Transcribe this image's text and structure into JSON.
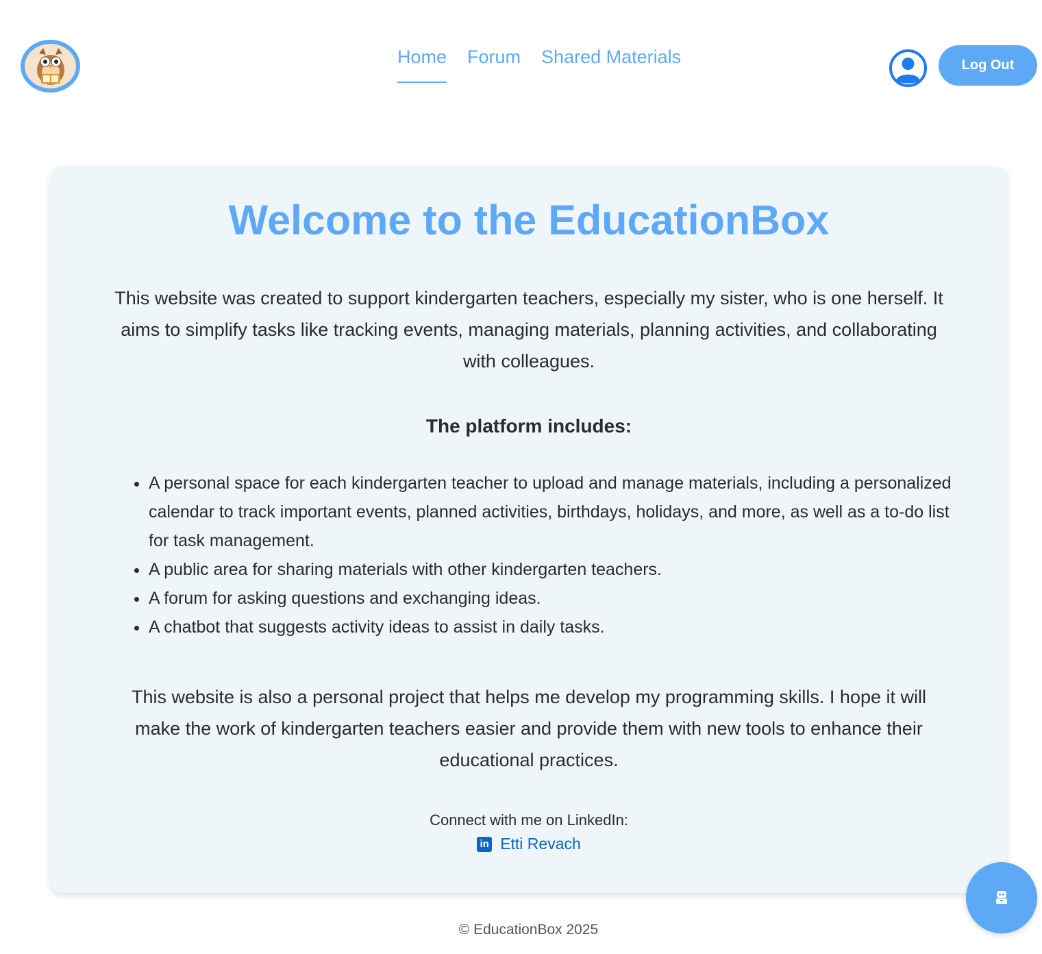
{
  "header": {
    "logo_icon": "owl-reading-book-icon",
    "nav": [
      {
        "label": "Home",
        "active": true
      },
      {
        "label": "Forum",
        "active": false
      },
      {
        "label": "Shared Materials",
        "active": false
      }
    ],
    "user_icon": "user-circle-icon",
    "logout_label": "Log Out"
  },
  "main": {
    "title": "Welcome to the EducationBox",
    "intro": "This website was created to support kindergarten teachers, especially my sister, who is one herself. It aims to simplify tasks like tracking events, managing materials, planning activities, and collaborating with colleagues.",
    "includes_title": "The platform includes:",
    "features": [
      "A personal space for each kindergarten teacher to upload and manage materials, including a personalized calendar to track important events, planned activities, birthdays, holidays, and more, as well as a to-do list for task management.",
      "A public area for sharing materials with other kindergarten teachers.",
      "A forum for asking questions and exchanging ideas.",
      "A chatbot that suggests activity ideas to assist in daily tasks."
    ],
    "outro": "This website is also a personal project that helps me develop my programming skills. I hope it will make the work of kindergarten teachers easier and provide them with new tools to enhance their educational practices.",
    "connect_label": "Connect with me on LinkedIn:",
    "linkedin_icon": "linkedin-icon",
    "linkedin_name": "Etti Revach"
  },
  "footer": {
    "copyright": "© EducationBox 2025"
  },
  "chatbot": {
    "icon": "robot-icon"
  },
  "colors": {
    "accent": "#5ea9f6",
    "card_bg": "#eff6fa",
    "linkedin": "#0a66c2",
    "text": "#2b2b2b"
  }
}
